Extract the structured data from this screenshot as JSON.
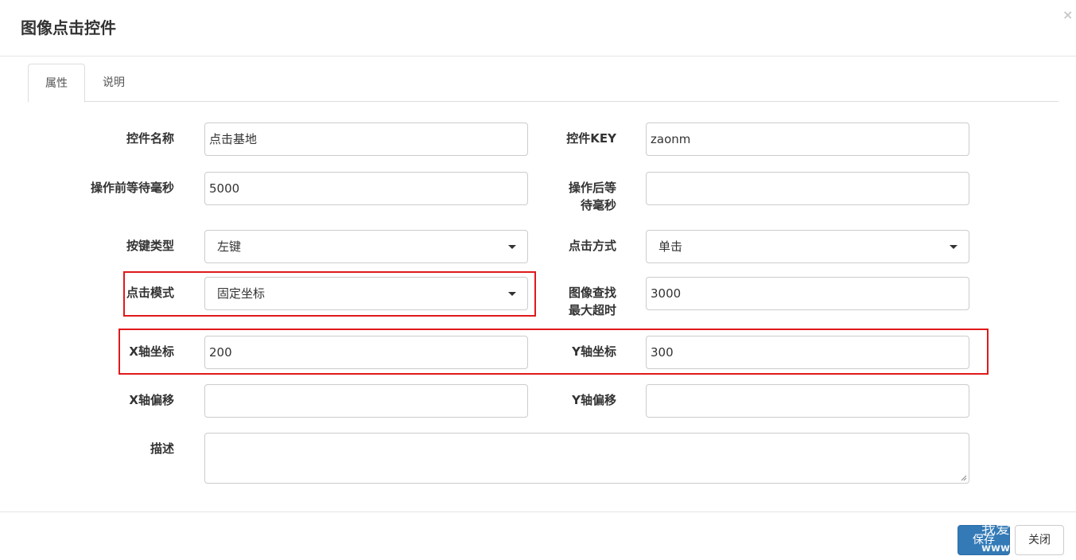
{
  "dialog": {
    "title": "图像点击控件",
    "close_symbol": "×"
  },
  "tabs": [
    {
      "label": "属性",
      "active": true
    },
    {
      "label": "说明",
      "active": false
    }
  ],
  "form": {
    "control_name": {
      "label": "控件名称",
      "value": "点击基地"
    },
    "control_key": {
      "label": "控件KEY",
      "value": "zaonm"
    },
    "wait_before": {
      "label": "操作前等待毫秒",
      "value": "5000"
    },
    "wait_after": {
      "label_line1": "操作后等",
      "label_line2": "待毫秒",
      "value": ""
    },
    "key_type": {
      "label": "按键类型",
      "selected": "左键"
    },
    "click_method": {
      "label": "点击方式",
      "selected": "单击"
    },
    "click_mode": {
      "label": "点击模式",
      "selected": "固定坐标"
    },
    "image_timeout": {
      "label_line1": "图像查找",
      "label_line2": "最大超时",
      "value": "3000"
    },
    "x_coord": {
      "label": "X轴坐标",
      "value": "200"
    },
    "y_coord": {
      "label": "Y轴坐标",
      "value": "300"
    },
    "x_offset": {
      "label": "X轴偏移",
      "value": ""
    },
    "y_offset": {
      "label": "Y轴偏移",
      "value": ""
    },
    "description": {
      "label": "描述",
      "value": ""
    }
  },
  "footer": {
    "save_label": "保存",
    "close_label": "关闭",
    "watermark_line1": "我爱",
    "watermark_line2": "www."
  },
  "colors": {
    "primary": "#337ab7",
    "highlight": "#e0191b"
  }
}
